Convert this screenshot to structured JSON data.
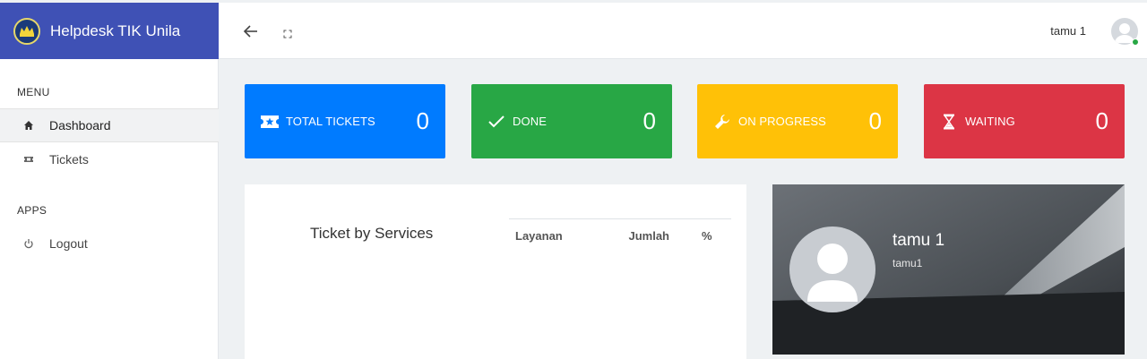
{
  "brand": {
    "title": "Helpdesk TIK Unila",
    "color": "#3f51b5"
  },
  "sidebar": {
    "menu_heading": "MENU",
    "items": [
      {
        "label": "Dashboard",
        "icon": "home-icon",
        "active": true
      },
      {
        "label": "Tickets",
        "icon": "ticket-icon",
        "active": false
      }
    ],
    "apps_heading": "APPS",
    "apps_items": [
      {
        "label": "Logout",
        "icon": "power-icon"
      }
    ]
  },
  "header": {
    "back_icon": "arrow-left-icon",
    "fullscreen_icon": "expand-icon",
    "user_name": "tamu 1",
    "avatar_icon": "user-avatar-icon",
    "status_color": "#28a745"
  },
  "stats": [
    {
      "label": "TOTAL TICKETS",
      "value": "0",
      "color": "#007bff",
      "icon": "ticket-icon"
    },
    {
      "label": "DONE",
      "value": "0",
      "color": "#28a745",
      "icon": "check-icon"
    },
    {
      "label": "ON PROGRESS",
      "value": "0",
      "color": "#ffc107",
      "icon": "wrench-icon"
    },
    {
      "label": "WAITING",
      "value": "0",
      "color": "#dc3545",
      "icon": "hourglass-icon"
    }
  ],
  "services_panel": {
    "title": "Ticket by Services",
    "columns": [
      "Layanan",
      "Jumlah",
      "%"
    ]
  },
  "profile_card": {
    "name": "tamu 1",
    "username": "tamu1",
    "avatar_icon": "user-avatar-icon"
  }
}
